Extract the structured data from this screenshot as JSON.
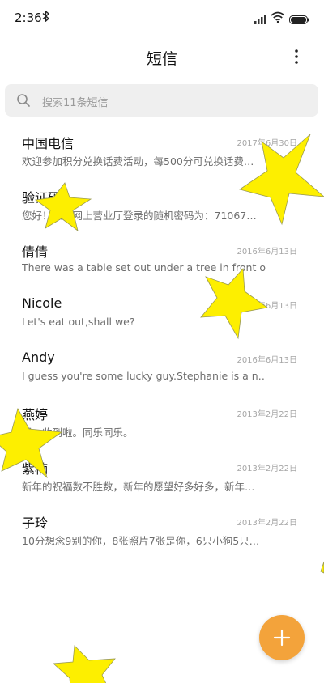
{
  "status_bar": {
    "time": "2:36",
    "icons": [
      "bluetooth-icon",
      "signal-icon",
      "wifi-icon",
      "battery-icon"
    ]
  },
  "header": {
    "title": "短信",
    "more_icon": "more-vertical-icon"
  },
  "search": {
    "placeholder": "搜索11条短信",
    "icon": "search-icon"
  },
  "messages": [
    {
      "name": "中国电信",
      "date": "2017年6月30日",
      "preview": "欢迎参加积分兑换话费活动，每500分可兑换话费…"
    },
    {
      "name": "验证码",
      "date": "",
      "preview": "您好！您的网上营业厅登录的随机密码为：71067…"
    },
    {
      "name": "倩倩",
      "date": "2016年6月13日",
      "preview": "There was a table set out under a tree in front o…"
    },
    {
      "name": "Nicole",
      "date": "2016年6月13日",
      "preview": "Let's eat out,shall we?"
    },
    {
      "name": "Andy",
      "date": "2016年6月13日",
      "preview": "I guess you're some lucky guy.Stephanie is a n…"
    },
    {
      "name": "燕婷",
      "date": "2013年2月22日",
      "preview": "嗯。收到啦。同乐同乐。"
    },
    {
      "name": "紫楠",
      "date": "2013年2月22日",
      "preview": "新年的祝福数不胜数，新年的愿望好多好多，新年…"
    },
    {
      "name": "子玲",
      "date": "2013年2月22日",
      "preview": "10分想念9别的你，8张照片7张是你，6只小狗5只…"
    }
  ],
  "fab": {
    "icon": "plus-icon"
  },
  "colors": {
    "accent": "#f3a33b",
    "star": "#fdef00",
    "search_bg": "#efefef"
  }
}
